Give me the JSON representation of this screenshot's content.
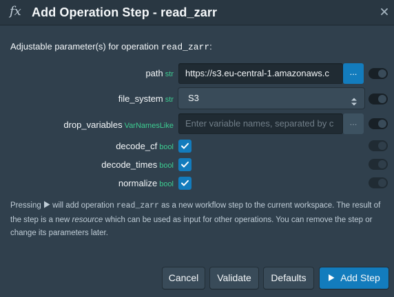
{
  "header": {
    "icon": "fx",
    "title": "Add Operation Step - read_zarr"
  },
  "intro": {
    "prefix": "Adjustable parameter(s) for operation ",
    "op": "read_zarr",
    "suffix": ":"
  },
  "params": [
    {
      "name": "path",
      "type": "str",
      "value": "https://s3.eu-central-1.amazonaws.c",
      "control": "text"
    },
    {
      "name": "file_system",
      "type": "str",
      "value": "S3",
      "control": "select"
    },
    {
      "name": "drop_variables",
      "type": "VarNamesLike",
      "placeholder": "Enter variable names, separated by c",
      "control": "text"
    },
    {
      "name": "decode_cf",
      "type": "bool",
      "checked": true,
      "control": "checkbox"
    },
    {
      "name": "decode_times",
      "type": "bool",
      "checked": true,
      "control": "checkbox"
    },
    {
      "name": "normalize",
      "type": "bool",
      "checked": true,
      "control": "checkbox"
    }
  ],
  "ellipsis_label": "...",
  "note": {
    "p1": "Pressing ",
    "p2": " will add operation ",
    "op": "read_zarr",
    "p3": " as a new workflow step to the current workspace. The result of the step is a new ",
    "em": "resource",
    "p4": " which can be used as input for other operations. You can remove the step or change its parameters later."
  },
  "buttons": {
    "cancel": "Cancel",
    "validate": "Validate",
    "defaults": "Defaults",
    "add_step": "Add Step"
  },
  "colors": {
    "primary": "#137cbd",
    "type_green": "#3dcc91",
    "background": "#30404d"
  }
}
